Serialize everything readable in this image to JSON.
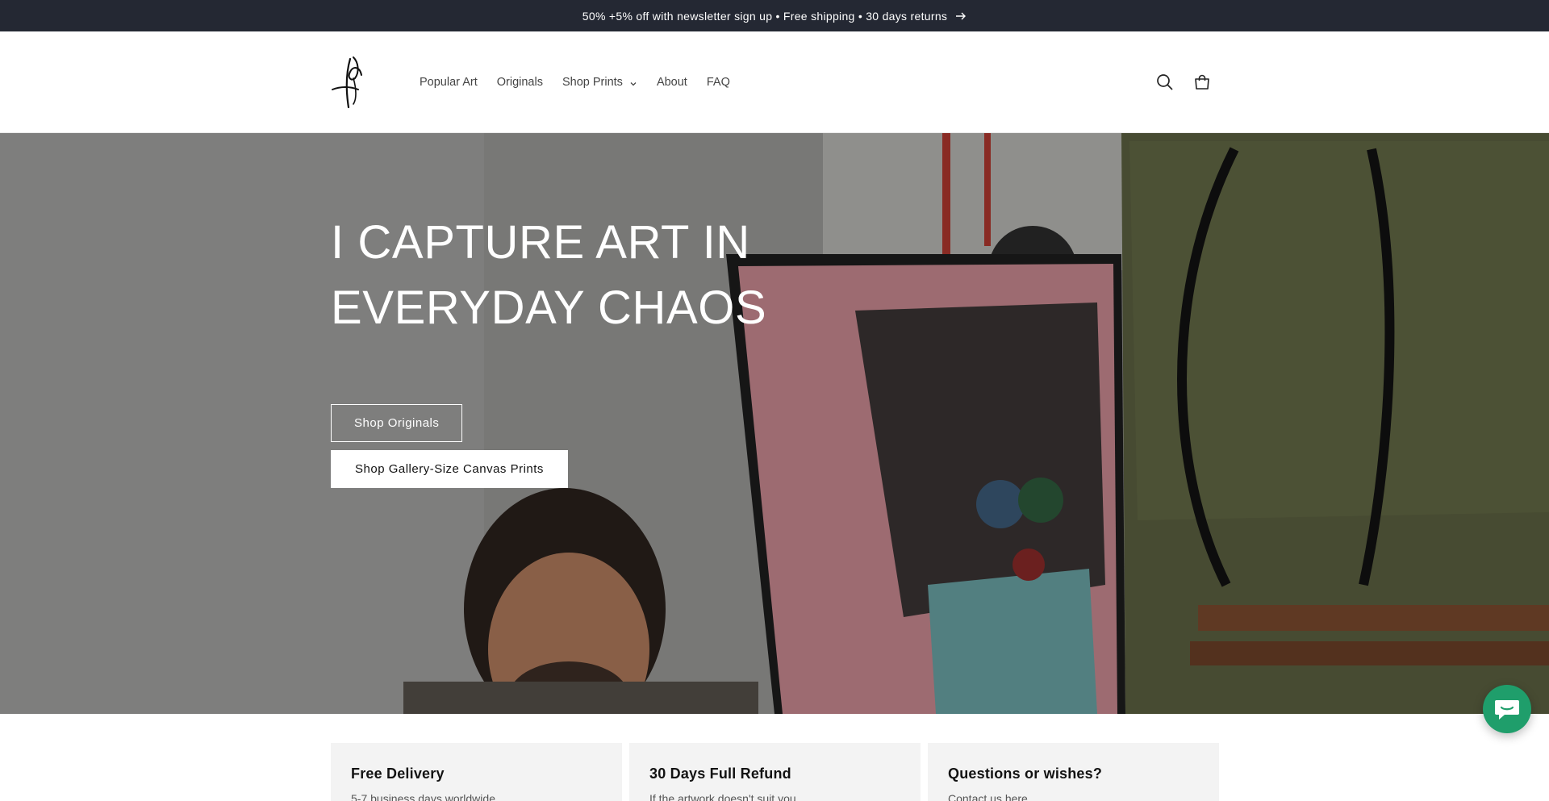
{
  "announcement": {
    "text": "50% +5% off with newsletter sign up • Free shipping • 30 days returns",
    "arrow_icon": "arrow-right-icon"
  },
  "header": {
    "logo_icon": "signature-logo-icon",
    "nav": [
      {
        "label": "Popular Art"
      },
      {
        "label": "Originals"
      },
      {
        "label": "Shop Prints",
        "has_dropdown": true
      },
      {
        "label": "About"
      },
      {
        "label": "FAQ"
      }
    ],
    "search_icon": "search-icon",
    "cart_icon": "cart-icon"
  },
  "hero": {
    "title_line1": "I CAPTURE ART IN",
    "title_line2": "EVERYDAY CHAOS",
    "button_primary": "Shop Originals",
    "button_secondary": "Shop Gallery-Size Canvas Prints"
  },
  "cards": [
    {
      "title": "Free Delivery",
      "text": "5-7 business days worldwide"
    },
    {
      "title": "30 Days Full Refund",
      "text": "If the artwork doesn't suit you"
    },
    {
      "title": "Questions or wishes?",
      "text": "Contact us here"
    }
  ],
  "chat": {
    "icon": "chat-bubble-icon"
  },
  "colors": {
    "announcement_bg": "#242833",
    "card_bg": "#f3f3f3",
    "chat_bg": "#1f9e6b"
  }
}
